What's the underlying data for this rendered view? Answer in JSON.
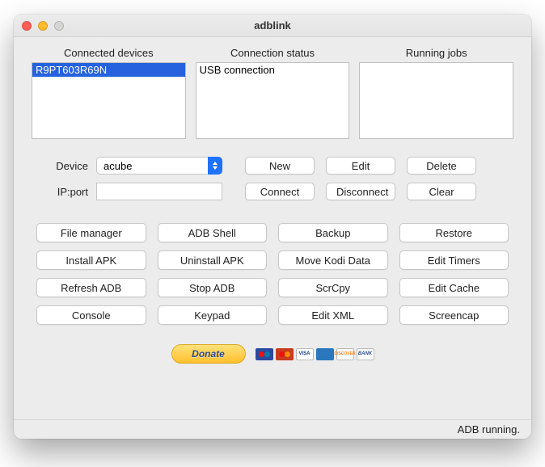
{
  "window": {
    "title": "adblink"
  },
  "panels": {
    "connected": {
      "label": "Connected devices",
      "items": [
        "R9PT603R69N"
      ],
      "selected_index": 0
    },
    "status": {
      "label": "Connection status",
      "items": [
        "USB connection"
      ]
    },
    "jobs": {
      "label": "Running jobs",
      "items": []
    }
  },
  "form": {
    "device_label": "Device",
    "device_value": "acube",
    "ipport_label": "IP:port",
    "ipport_value": "",
    "buttons": {
      "new": "New",
      "edit": "Edit",
      "delete": "Delete",
      "connect": "Connect",
      "disconnect": "Disconnect",
      "clear": "Clear"
    }
  },
  "tools": {
    "file_manager": "File manager",
    "adb_shell": "ADB Shell",
    "backup": "Backup",
    "restore": "Restore",
    "install_apk": "Install APK",
    "uninstall_apk": "Uninstall APK",
    "move_kodi": "Move Kodi Data",
    "edit_timers": "Edit Timers",
    "refresh_adb": "Refresh ADB",
    "stop_adb": "Stop ADB",
    "scrcpy": "ScrCpy",
    "edit_cache": "Edit Cache",
    "console": "Console",
    "keypad": "Keypad",
    "edit_xml": "Edit XML",
    "screencap": "Screencap"
  },
  "donate": {
    "label": "Donate"
  },
  "cards": {
    "visa": "VISA",
    "amex": "AMEX",
    "disc": "DISCOVER",
    "bank": "BANK"
  },
  "statusbar": {
    "text": "ADB running."
  }
}
